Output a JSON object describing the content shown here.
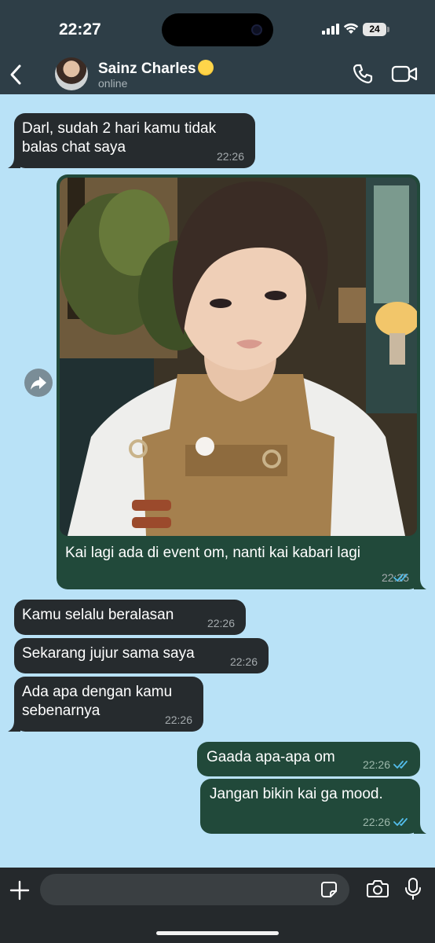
{
  "status_bar": {
    "time": "22:27",
    "battery": "24"
  },
  "header": {
    "contact_name": "Sainz Charles",
    "contact_status": "online"
  },
  "messages": [
    {
      "direction": "incoming",
      "lines": [
        "Darl, sudah 2 hari kamu tidak",
        "balas chat saya"
      ],
      "time": "22:26"
    },
    {
      "direction": "outgoing",
      "type": "image",
      "caption": "Kai lagi ada di event om, nanti kai kabari lagi",
      "time": "22:25",
      "status": "read"
    },
    {
      "direction": "incoming",
      "lines": [
        "Kamu selalu beralasan"
      ],
      "time": "22:26"
    },
    {
      "direction": "incoming",
      "lines": [
        "Sekarang jujur sama saya"
      ],
      "time": "22:26"
    },
    {
      "direction": "incoming",
      "lines": [
        "Ada apa dengan kamu",
        "sebenarnya"
      ],
      "time": "22:26"
    },
    {
      "direction": "outgoing",
      "lines": [
        "Gaada apa-apa om"
      ],
      "time": "22:26",
      "status": "read"
    },
    {
      "direction": "outgoing",
      "lines": [
        "Jangan bikin kai ga mood."
      ],
      "time": "22:26",
      "status": "read"
    }
  ],
  "composer": {
    "value": "",
    "placeholder": ""
  },
  "icons": {
    "back": "chevron-left-icon",
    "call": "phone-icon",
    "video": "video-camera-icon",
    "forward": "forward-arrow-icon",
    "plus": "plus-icon",
    "sticker": "sticker-icon",
    "camera": "camera-icon",
    "mic": "microphone-icon",
    "read_receipt": "double-check-icon"
  },
  "colors": {
    "chat_background": "#b9e2f7",
    "header_background": "#2e3e47",
    "incoming_bubble": "#262b2e",
    "outgoing_bubble": "#21493a",
    "read_tick": "#53bdeb"
  }
}
